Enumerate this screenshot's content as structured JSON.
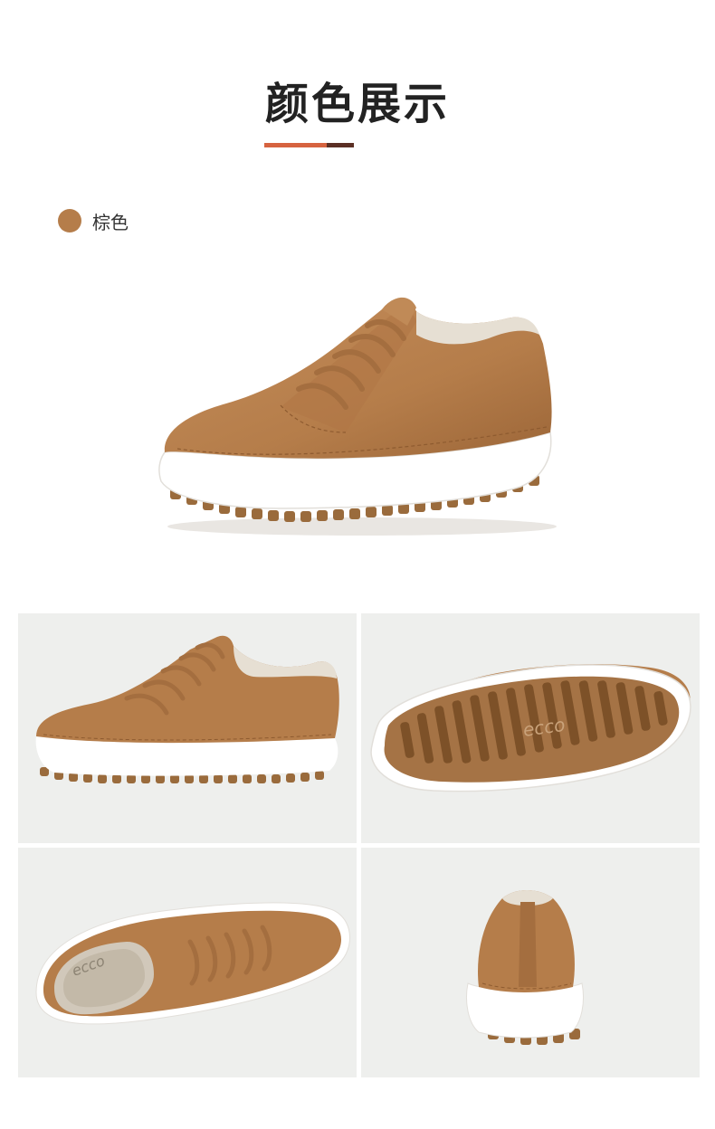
{
  "header": {
    "title": "颜色展示"
  },
  "color_swatch": {
    "label": "棕色",
    "color": "#b57d4a"
  },
  "colors": {
    "accent_orange": "#d6633f",
    "accent_dark": "#5b2f24",
    "leather": "#b57d4a",
    "sole_white": "#ffffff",
    "sole_gum": "#9a6b3c",
    "panel_bg": "#eeefed"
  },
  "gallery": {
    "views": [
      "side-view",
      "sole-view",
      "top-view",
      "back-view"
    ],
    "sole_brand": "ecco"
  }
}
